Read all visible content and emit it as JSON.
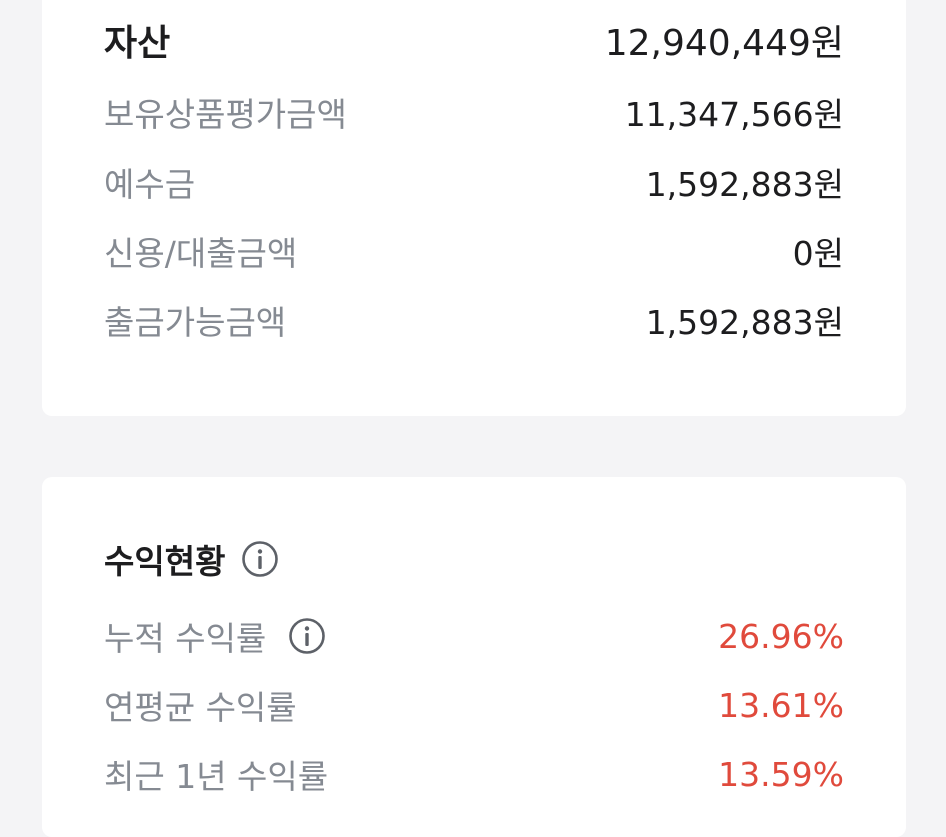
{
  "assets": {
    "title_label": "자산",
    "title_value": "12,940,449원",
    "items": [
      {
        "label": "보유상품평가금액",
        "value": "11,347,566원"
      },
      {
        "label": "예수금",
        "value": "1,592,883원"
      },
      {
        "label": "신용/대출금액",
        "value": "0원"
      },
      {
        "label": "출금가능금액",
        "value": "1,592,883원"
      }
    ]
  },
  "returns": {
    "title": "수익현황",
    "title_icon": "info-icon",
    "items": [
      {
        "label": "누적 수익률",
        "value": "26.96%",
        "icon": "info-icon"
      },
      {
        "label": "연평균 수익률",
        "value": "13.61%"
      },
      {
        "label": "최근 1년 수익률",
        "value": "13.59%"
      }
    ],
    "positive_color": "#e04a3c"
  }
}
